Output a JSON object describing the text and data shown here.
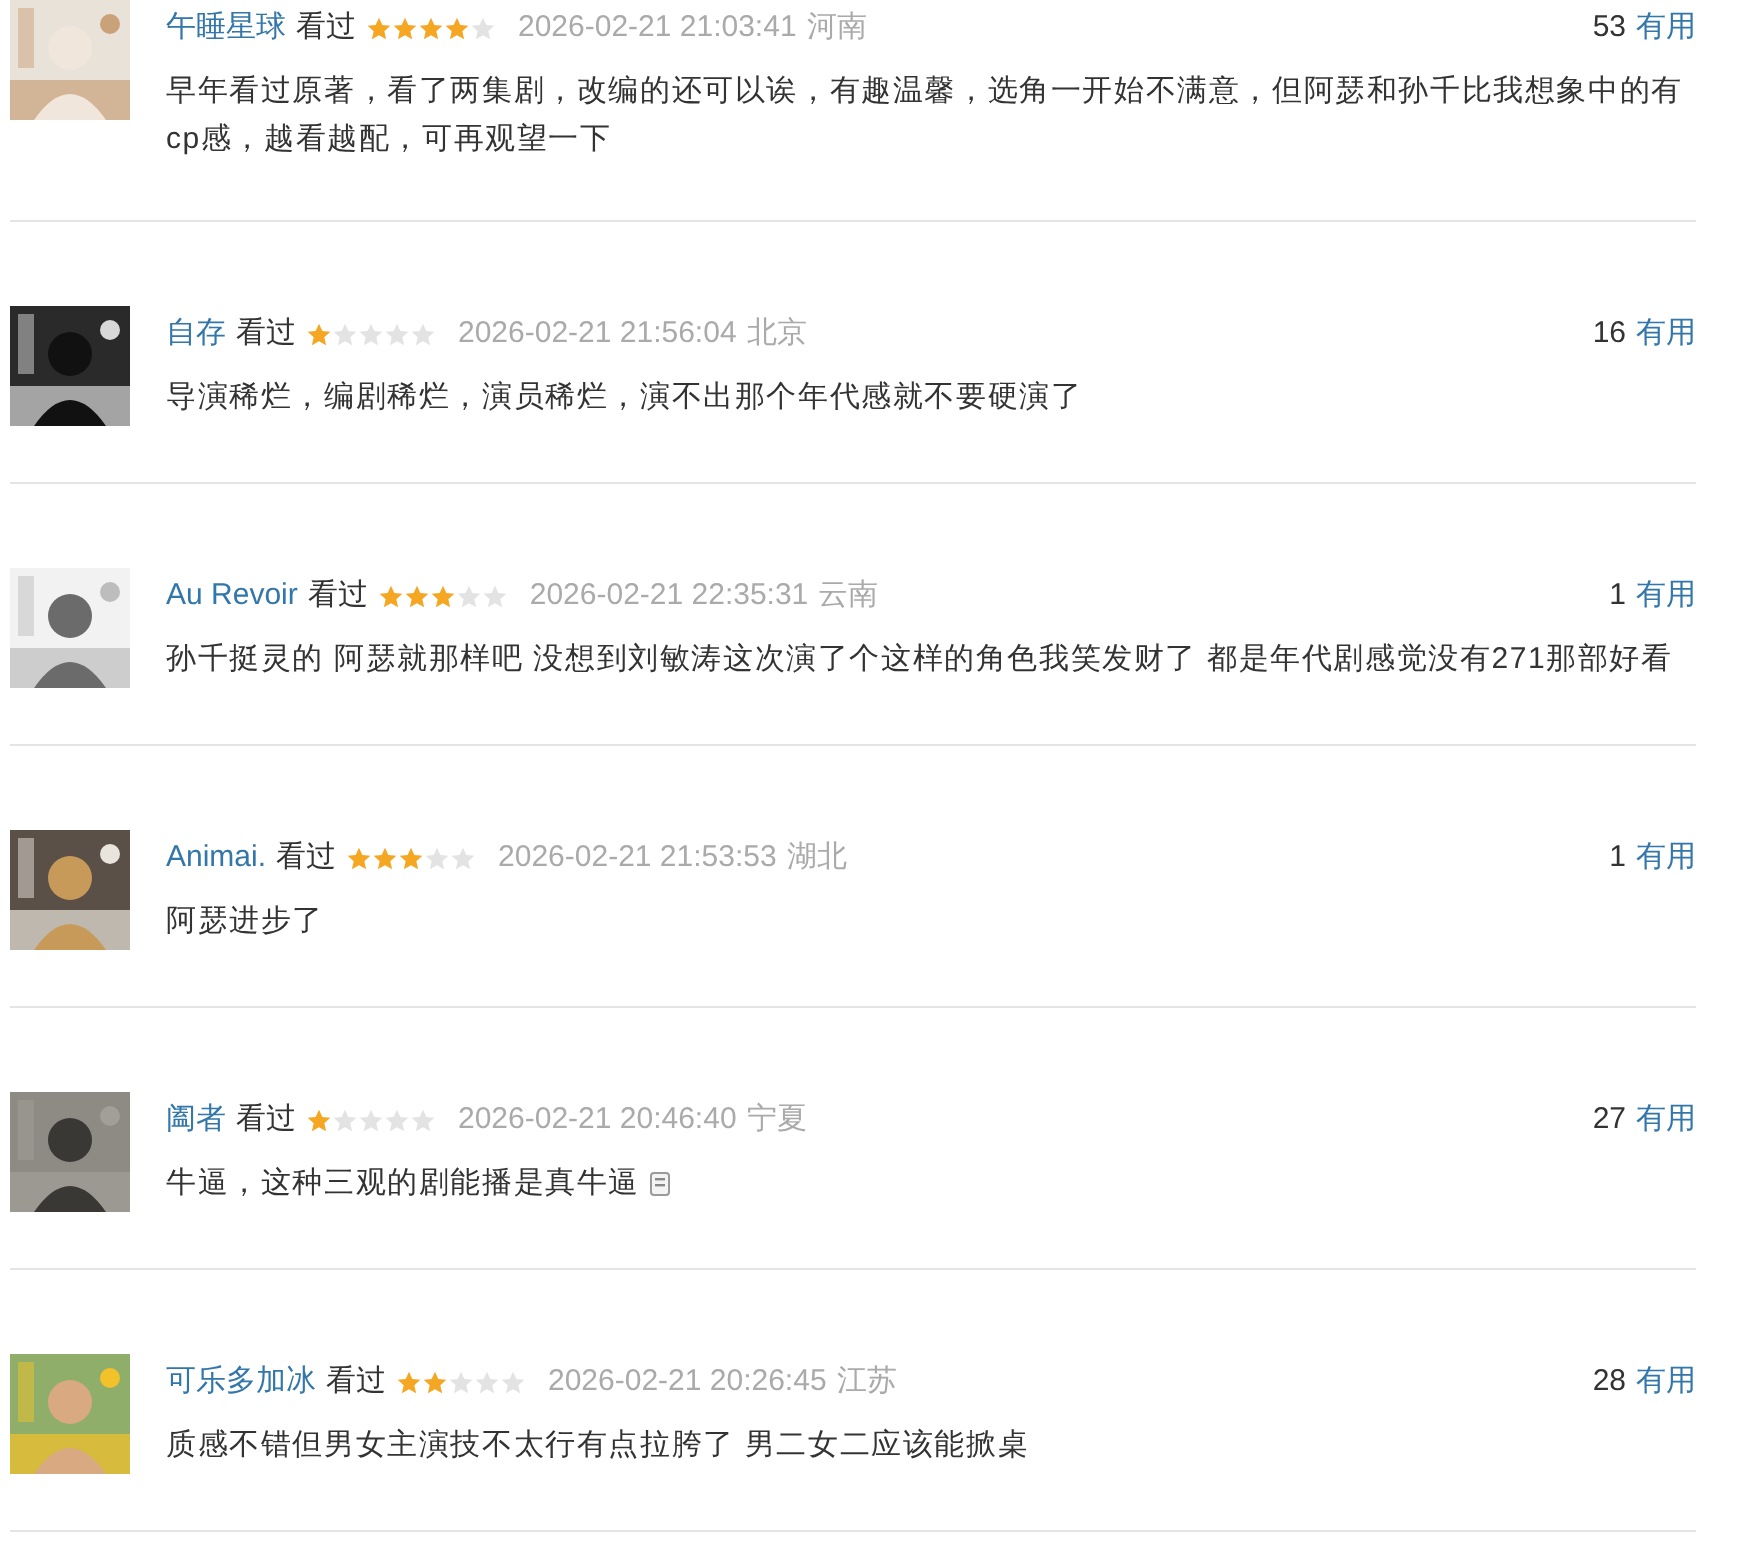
{
  "reviews": [
    {
      "user": "午睡星球",
      "status": "看过",
      "stars": 4,
      "time": "2026-02-21 21:03:41",
      "location": "河南",
      "votes": "53",
      "vote_label": "有用",
      "text": "早年看过原著，看了两集剧，改编的还可以诶，有趣温馨，选角一开始不满意，但阿瑟和孙千比我想象中的有cp感，越看越配，可再观望一下",
      "sticker": false
    },
    {
      "user": "自存",
      "status": "看过",
      "stars": 1,
      "time": "2026-02-21 21:56:04",
      "location": "北京",
      "votes": "16",
      "vote_label": "有用",
      "text": "导演稀烂，编剧稀烂，演员稀烂，演不出那个年代感就不要硬演了",
      "sticker": false
    },
    {
      "user": "Au Revoir",
      "status": "看过",
      "stars": 3,
      "time": "2026-02-21 22:35:31",
      "location": "云南",
      "votes": "1",
      "vote_label": "有用",
      "text": "孙千挺灵的 阿瑟就那样吧 没想到刘敏涛这次演了个这样的角色我笑发财了 都是年代剧感觉没有271那部好看",
      "sticker": false
    },
    {
      "user": "Animai.",
      "status": "看过",
      "stars": 3,
      "time": "2026-02-21 21:53:53",
      "location": "湖北",
      "votes": "1",
      "vote_label": "有用",
      "text": "阿瑟进步了",
      "sticker": false
    },
    {
      "user": "阖者",
      "status": "看过",
      "stars": 1,
      "time": "2026-02-21 20:46:40",
      "location": "宁夏",
      "votes": "27",
      "vote_label": "有用",
      "text": "牛逼，这种三观的剧能播是真牛逼",
      "sticker": true
    },
    {
      "user": "可乐多加冰",
      "status": "看过",
      "stars": 2,
      "time": "2026-02-21 20:26:45",
      "location": "江苏",
      "votes": "28",
      "vote_label": "有用",
      "text": "质感不错但男女主演技不太行有点拉胯了 男二女二应该能掀桌",
      "sticker": false
    }
  ]
}
